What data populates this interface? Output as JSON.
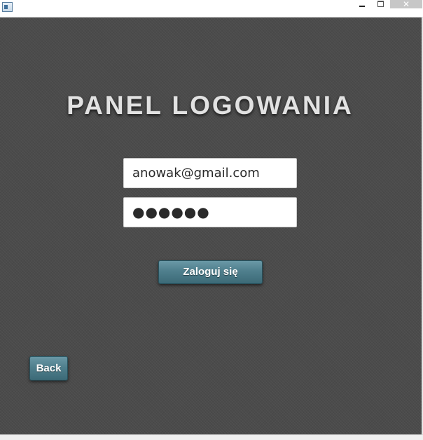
{
  "window": {
    "title_icon": "app-window-icon",
    "controls": {
      "minimize": "minimize-icon",
      "maximize": "maximize-icon",
      "close_glyph": "✕"
    }
  },
  "login": {
    "heading": "PANEL LOGOWANIA",
    "email_value": "anowak@gmail.com",
    "password_value": "●●●●●●",
    "submit_label": "Zaloguj się",
    "back_label": "Back"
  },
  "colors": {
    "background": "#4b4b4b",
    "button": "#4f7f8d",
    "heading": "#e2e2e2"
  }
}
